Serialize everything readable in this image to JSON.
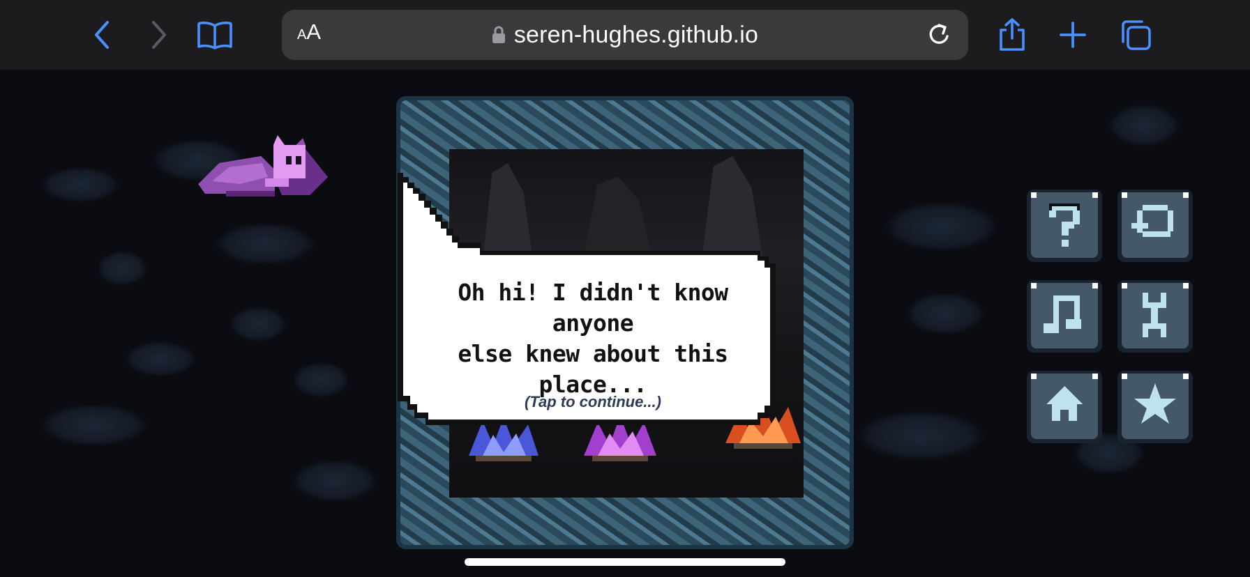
{
  "browser": {
    "text_size_button": {
      "small": "A",
      "large": "A"
    },
    "url": "seren-hughes.github.io",
    "icons": {
      "back": "chevron-left-icon",
      "forward": "chevron-right-icon",
      "bookmarks": "book-icon",
      "lock": "lock-icon",
      "reload": "reload-icon",
      "share": "share-icon",
      "new_tab": "plus-icon",
      "tabs": "tabs-icon"
    },
    "accent_color": "#4a90ff"
  },
  "game": {
    "dialog": {
      "line1": "Oh hi! I didn't know anyone",
      "line2": "else knew about this place...",
      "hint": "(Tap to continue...)"
    },
    "buttons": [
      {
        "id": "help",
        "icon": "question-mark-icon"
      },
      {
        "id": "restart",
        "icon": "restart-icon"
      },
      {
        "id": "music",
        "icon": "music-note-icon"
      },
      {
        "id": "settings",
        "icon": "wrench-icon"
      },
      {
        "id": "home",
        "icon": "house-icon"
      },
      {
        "id": "star",
        "icon": "star-icon"
      }
    ],
    "colors": {
      "button_face": "#45586a",
      "button_icon": "#bfe3ee",
      "character": "#c77dd9",
      "cave_rock": "#3d6478"
    }
  }
}
